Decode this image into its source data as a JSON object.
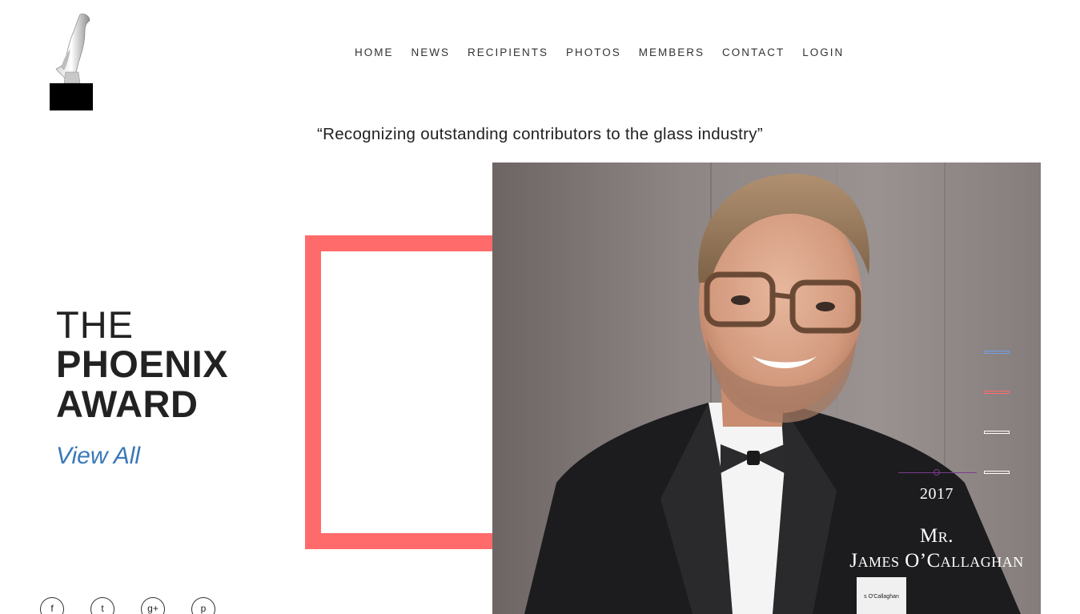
{
  "nav": {
    "items": [
      "HOME",
      "NEWS",
      "RECIPIENTS",
      "PHOTOS",
      "MEMBERS",
      "CONTACT",
      "LOGIN"
    ]
  },
  "tagline": "“Recognizing outstanding contributors to the glass industry”",
  "headline": {
    "line1": "THE",
    "line2": "PHOENIX",
    "line3": "AWARD"
  },
  "view_all": "View All",
  "slide": {
    "year": "2017",
    "name_line1": "Mr.",
    "name_line2": "James O’Callaghan",
    "badge_text": "s O'Callaghan"
  },
  "indicators": [
    {
      "color": "#6fa0e8",
      "active": true
    },
    {
      "color": "#ff6b6b",
      "active": false
    },
    {
      "color": "#ffffff",
      "active": false
    },
    {
      "color": "#ffffff",
      "active": false
    }
  ],
  "colors": {
    "accent_coral": "#ff6b6b",
    "link_blue": "#3a78b8",
    "caption_purple": "#7a3b8f"
  },
  "social": [
    {
      "icon": "facebook-icon",
      "glyph": "f"
    },
    {
      "icon": "twitter-icon",
      "glyph": "t"
    },
    {
      "icon": "google-plus-icon",
      "glyph": "g+"
    },
    {
      "icon": "pinterest-icon",
      "glyph": "p"
    }
  ]
}
